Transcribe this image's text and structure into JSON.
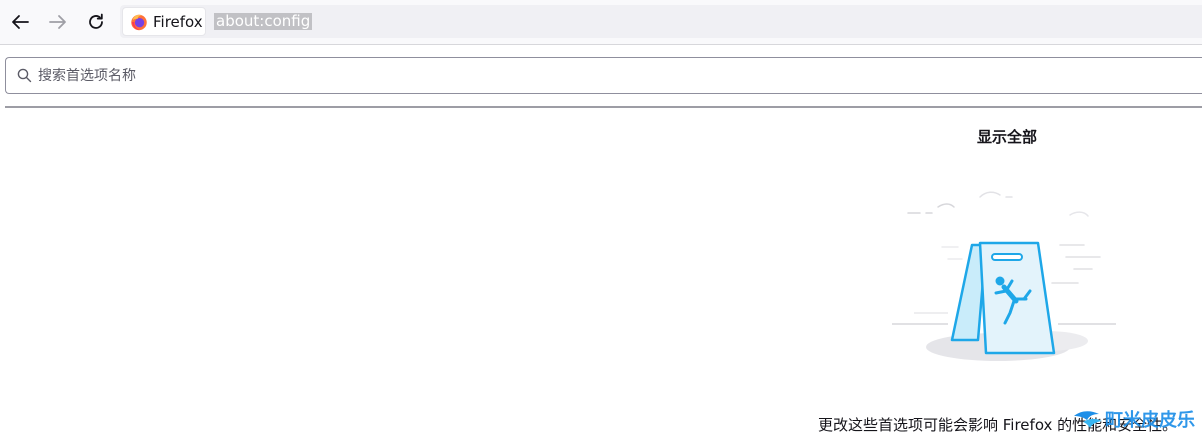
{
  "browser": {
    "identity_label": "Firefox",
    "url": "about:config"
  },
  "search": {
    "placeholder": "搜索首选项名称",
    "value": ""
  },
  "main": {
    "show_all_label": "显示全部",
    "warning_text": "更改这些首选项可能会影响 Firefox 的性能和安全性。"
  },
  "watermark": {
    "text": "町米皮皮乐"
  },
  "colors": {
    "accent": "#1ea7e8",
    "sign_fill": "#e3f3fb"
  }
}
